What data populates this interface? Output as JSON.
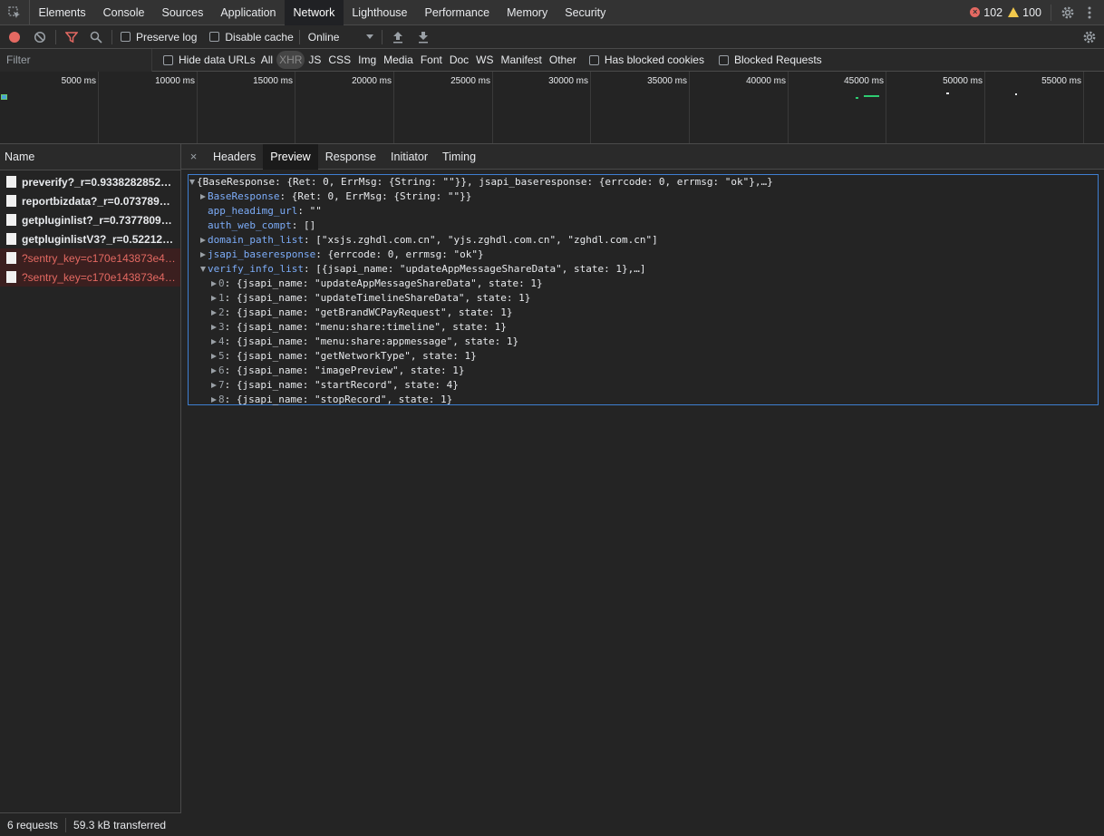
{
  "tabs": [
    "Elements",
    "Console",
    "Sources",
    "Application",
    "Network",
    "Lighthouse",
    "Performance",
    "Memory",
    "Security"
  ],
  "active_tab": "Network",
  "errors_count": "102",
  "warnings_count": "100",
  "toolbar": {
    "preserve_log": "Preserve log",
    "disable_cache": "Disable cache",
    "throttling": "Online"
  },
  "filterbar": {
    "placeholder": "Filter",
    "hide_data_urls": "Hide data URLs",
    "types": [
      "All",
      "XHR",
      "JS",
      "CSS",
      "Img",
      "Media",
      "Font",
      "Doc",
      "WS",
      "Manifest",
      "Other"
    ],
    "active_type": "XHR",
    "has_blocked_cookies": "Has blocked cookies",
    "blocked_requests": "Blocked Requests"
  },
  "overview": {
    "ticks": [
      "5000 ms",
      "10000 ms",
      "15000 ms",
      "20000 ms",
      "25000 ms",
      "30000 ms",
      "35000 ms",
      "40000 ms",
      "45000 ms",
      "50000 ms",
      "55000 ms"
    ]
  },
  "requests": {
    "header": "Name",
    "items": [
      {
        "name": "preverify?_r=0.933828285283...",
        "error": false
      },
      {
        "name": "reportbizdata?_r=0.07378916...",
        "error": false
      },
      {
        "name": "getpluginlist?_r=0.737780952...",
        "error": false
      },
      {
        "name": "getpluginlistV3?_r=0.5221222...",
        "error": false
      },
      {
        "name": "?sentry_key=c170e143873e44...",
        "error": true
      },
      {
        "name": "?sentry_key=c170e143873e44...",
        "error": true
      }
    ]
  },
  "status": {
    "requests": "6 requests",
    "transferred": "59.3 kB transferred"
  },
  "detail_tabs": [
    "Headers",
    "Preview",
    "Response",
    "Initiator",
    "Timing"
  ],
  "active_detail_tab": "Preview",
  "preview": {
    "root": "{BaseResponse: {Ret: 0, ErrMsg: {String: \"\"}}, jsapi_baseresponse: {errcode: 0, errmsg: \"ok\"},…}",
    "lines": [
      {
        "key": "BaseResponse",
        "value": "{Ret: 0, ErrMsg: {String: \"\"}}",
        "expander": "collapsed"
      },
      {
        "key": "app_headimg_url",
        "value": "\"\"",
        "expander": "none"
      },
      {
        "key": "auth_web_compt",
        "value": "[]",
        "expander": "none"
      },
      {
        "key": "domain_path_list",
        "value": "[\"xsjs.zghdl.com.cn\", \"yjs.zghdl.com.cn\", \"zghdl.com.cn\"]",
        "expander": "collapsed"
      },
      {
        "key": "jsapi_baseresponse",
        "value": "{errcode: 0, errmsg: \"ok\"}",
        "expander": "collapsed"
      },
      {
        "key": "verify_info_list",
        "value": "[{jsapi_name: \"updateAppMessageShareData\", state: 1},…]",
        "expander": "expanded"
      }
    ],
    "verify_items": [
      {
        "idx": "0",
        "value": "{jsapi_name: \"updateAppMessageShareData\", state: 1}"
      },
      {
        "idx": "1",
        "value": "{jsapi_name: \"updateTimelineShareData\", state: 1}"
      },
      {
        "idx": "2",
        "value": "{jsapi_name: \"getBrandWCPayRequest\", state: 1}"
      },
      {
        "idx": "3",
        "value": "{jsapi_name: \"menu:share:timeline\", state: 1}"
      },
      {
        "idx": "4",
        "value": "{jsapi_name: \"menu:share:appmessage\", state: 1}"
      },
      {
        "idx": "5",
        "value": "{jsapi_name: \"getNetworkType\", state: 1}"
      },
      {
        "idx": "6",
        "value": "{jsapi_name: \"imagePreview\", state: 1}"
      },
      {
        "idx": "7",
        "value": "{jsapi_name: \"startRecord\", state: 4}"
      },
      {
        "idx": "8",
        "value": "{jsapi_name: \"stopRecord\", state: 1}"
      }
    ]
  },
  "colors": {
    "accent": "#3e7fd1",
    "record": "#e46962",
    "error": "#e46962",
    "warning": "#f2c94c",
    "key": "#7cacf8"
  }
}
